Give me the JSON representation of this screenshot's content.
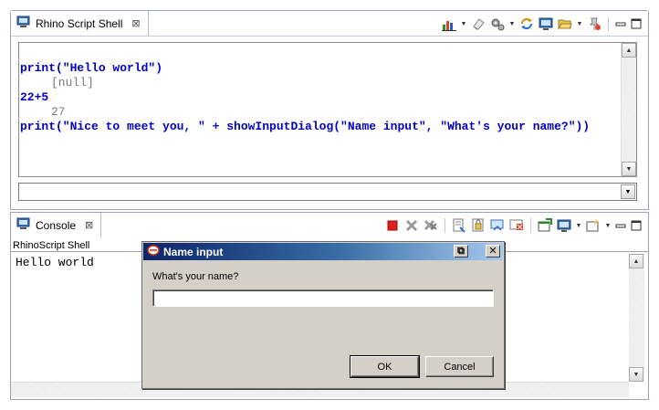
{
  "shell": {
    "tab_title": "Rhino Script Shell",
    "tab_close": "⊠",
    "lines": [
      {
        "kind": "in",
        "text": "print(\"Hello world\")"
      },
      {
        "kind": "out",
        "text": "[null]"
      },
      {
        "kind": "in",
        "text": "22+5"
      },
      {
        "kind": "out",
        "text": "27"
      },
      {
        "kind": "in",
        "text": "print(\"Nice to meet you, \" + showInputDialog(\"Name input\", \"What's your name?\"))"
      }
    ],
    "input_value": ""
  },
  "console": {
    "tab_title": "Console",
    "tab_close": "⊠",
    "label": "RhinoScript Shell",
    "output": "Hello world"
  },
  "dialog": {
    "title": "Name input",
    "prompt": "What's your name?",
    "input_value": "",
    "ok_label": "OK",
    "cancel_label": "Cancel"
  },
  "icons": {
    "restore": "⧉",
    "close": "✕"
  },
  "colors": {
    "input_code": "#0000c8",
    "output_code": "#7a7a7a",
    "dialog_title_start": "#0a246a",
    "dialog_title_end": "#a6caf0"
  }
}
